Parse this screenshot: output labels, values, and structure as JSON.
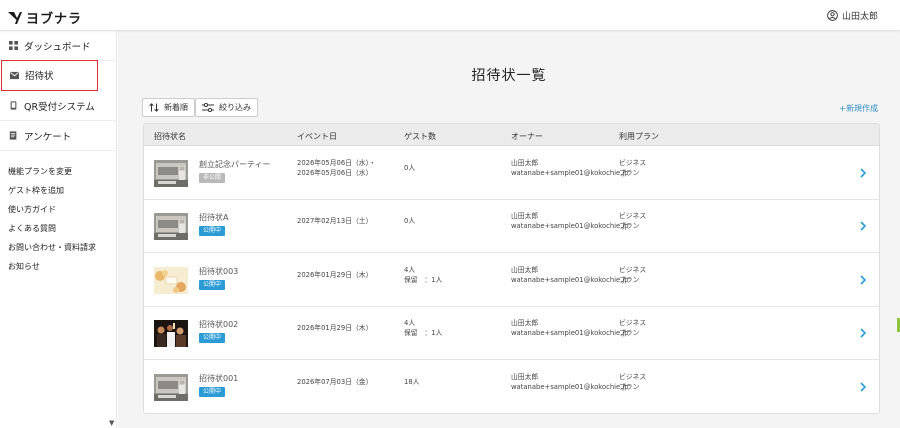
{
  "app": {
    "brand": "ヨブナラ",
    "user_name": "山田太郎"
  },
  "sidebar": {
    "items": [
      {
        "label": "ダッシュボード",
        "icon": "dashboard-icon"
      },
      {
        "label": "招待状",
        "icon": "mail-icon",
        "active": true
      },
      {
        "label": "QR受付システム",
        "icon": "phone-icon"
      },
      {
        "label": "アンケート",
        "icon": "survey-icon"
      }
    ],
    "links": [
      "機能プランを変更",
      "ゲスト枠を追加",
      "使い方ガイド",
      "よくある質問",
      "お問い合わせ・資料請求",
      "お知らせ"
    ]
  },
  "main": {
    "title": "招待状一覧",
    "sort_label": "新着順",
    "filter_label": "絞り込み",
    "new_link": "+新規作成",
    "columns": [
      "招待状名",
      "イベント日",
      "ゲスト数",
      "オーナー",
      "利用プラン"
    ],
    "rows": [
      {
        "name": "創立記念パーティー",
        "status": "非公開",
        "public": false,
        "date1": "2026年05月06日（水）・",
        "date2": "2026年05月06日（水）",
        "guests1": "0人",
        "guests2": "",
        "owner1": "山田太郎",
        "owner2": "watanabe+sample01@kokochie.jp",
        "plan1": "ビジネス",
        "plan2": "プラン",
        "thumb": "gray"
      },
      {
        "name": "招待状A",
        "status": "公開中",
        "public": true,
        "date1": "2027年02月13日（土）",
        "date2": "",
        "guests1": "0人",
        "guests2": "",
        "owner1": "山田太郎",
        "owner2": "watanabe+sample01@kokochie.jp",
        "plan1": "ビジネス",
        "plan2": "プラン",
        "thumb": "gray"
      },
      {
        "name": "招待状003",
        "status": "公開中",
        "public": true,
        "date1": "2026年01月29日（木）",
        "date2": "",
        "guests1": "4人",
        "guests2": "保留　：1人",
        "owner1": "山田太郎",
        "owner2": "watanabe+sample01@kokochie.jp",
        "plan1": "ビジネス",
        "plan2": "プラン",
        "thumb": "floral"
      },
      {
        "name": "招待状002",
        "status": "公開中",
        "public": true,
        "date1": "2026年01月29日（木）",
        "date2": "",
        "guests1": "4人",
        "guests2": "保留　：1人",
        "owner1": "山田太郎",
        "owner2": "watanabe+sample01@kokochie.jp",
        "plan1": "ビジネス",
        "plan2": "プラン",
        "thumb": "party"
      },
      {
        "name": "招待状001",
        "status": "公開中",
        "public": true,
        "date1": "2026年07月03日（金）",
        "date2": "",
        "guests1": "18人",
        "guests2": "",
        "owner1": "山田太郎",
        "owner2": "watanabe+sample01@kokochie.jp",
        "plan1": "ビジネス",
        "plan2": "プラン",
        "thumb": "gray"
      }
    ]
  },
  "colors": {
    "accent": "#2b9bd6",
    "active_border": "#d9302c",
    "background": "#f4f4f4",
    "badge_private": "#b9b9b9"
  }
}
